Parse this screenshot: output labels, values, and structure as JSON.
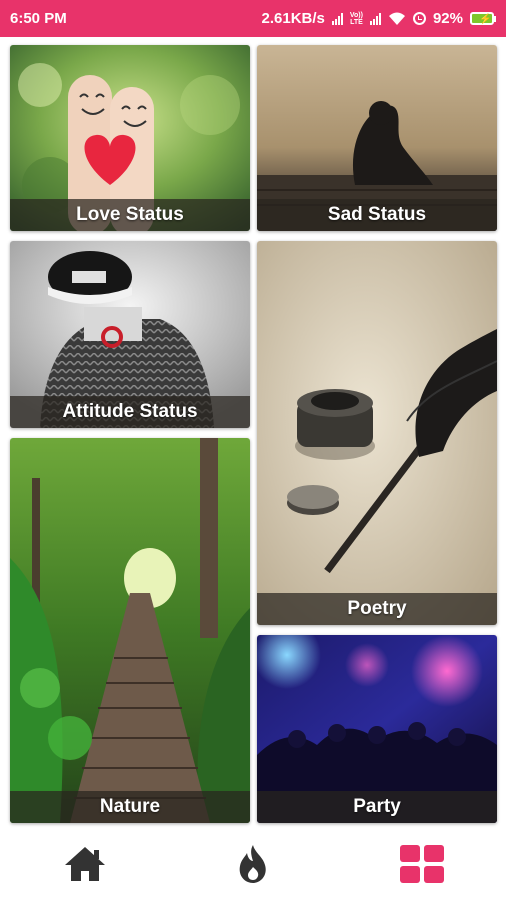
{
  "status_bar": {
    "time": "6:50 PM",
    "net_speed": "2.61KB/s",
    "battery": "92%",
    "volte_line1": "Vo))",
    "volte_line2": "LTE"
  },
  "categories": [
    {
      "label": "Love Status"
    },
    {
      "label": "Sad Status"
    },
    {
      "label": "Attitude Status"
    },
    {
      "label": "Poetry"
    },
    {
      "label": "Nature"
    },
    {
      "label": "Party"
    }
  ],
  "bottom_nav": {
    "items": [
      {
        "icon": "home-icon",
        "active": false
      },
      {
        "icon": "flame-icon",
        "active": false
      },
      {
        "icon": "grid-icon",
        "active": true
      }
    ],
    "active_color": "#e8336a",
    "inactive_color": "#333333"
  },
  "colors": {
    "accent": "#e8336a"
  }
}
